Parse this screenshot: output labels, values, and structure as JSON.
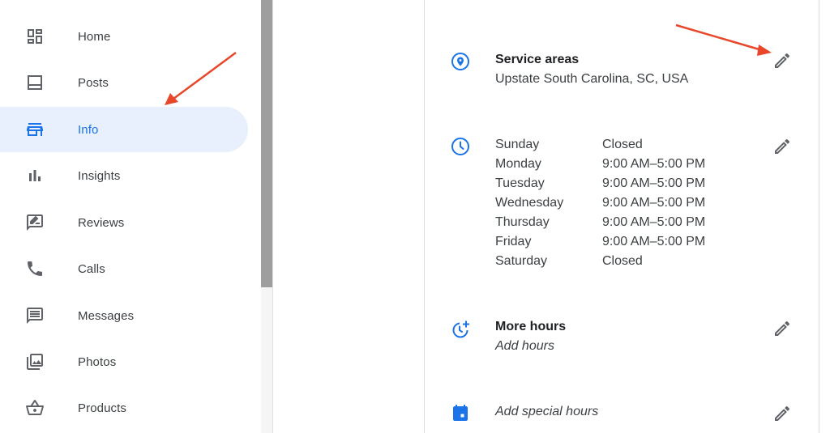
{
  "sidebar": {
    "items": [
      {
        "label": "Home",
        "icon": "dashboard-icon"
      },
      {
        "label": "Posts",
        "icon": "posts-icon"
      },
      {
        "label": "Info",
        "icon": "storefront-icon",
        "active": true
      },
      {
        "label": "Insights",
        "icon": "bar-chart-icon"
      },
      {
        "label": "Reviews",
        "icon": "rate-review-icon"
      },
      {
        "label": "Calls",
        "icon": "phone-icon"
      },
      {
        "label": "Messages",
        "icon": "message-icon"
      },
      {
        "label": "Photos",
        "icon": "photo-library-icon"
      },
      {
        "label": "Products",
        "icon": "shopping-basket-icon"
      }
    ]
  },
  "main": {
    "service_areas": {
      "title": "Service areas",
      "value": "Upstate South Carolina, SC, USA"
    },
    "hours": [
      {
        "day": "Sunday",
        "time": "Closed"
      },
      {
        "day": "Monday",
        "time": "9:00 AM–5:00 PM"
      },
      {
        "day": "Tuesday",
        "time": "9:00 AM–5:00 PM"
      },
      {
        "day": "Wednesday",
        "time": "9:00 AM–5:00 PM"
      },
      {
        "day": "Thursday",
        "time": "9:00 AM–5:00 PM"
      },
      {
        "day": "Friday",
        "time": "9:00 AM–5:00 PM"
      },
      {
        "day": "Saturday",
        "time": "Closed"
      }
    ],
    "more_hours": {
      "title": "More hours",
      "value": "Add hours"
    },
    "special_hours": {
      "value": "Add special hours"
    }
  },
  "colors": {
    "accent": "#1a73e8",
    "active_bg": "#e8f0fe",
    "annotation_arrow": "#e8472b",
    "icon_gray": "#5f6368"
  }
}
